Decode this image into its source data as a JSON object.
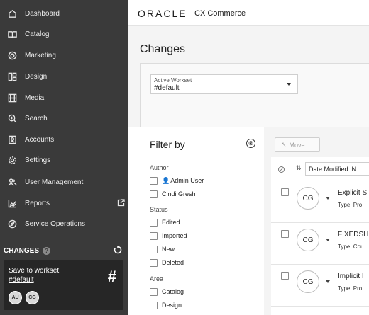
{
  "sidebar": {
    "items": [
      {
        "label": "Dashboard",
        "icon": "home-icon"
      },
      {
        "label": "Catalog",
        "icon": "book-icon"
      },
      {
        "label": "Marketing",
        "icon": "target-icon"
      },
      {
        "label": "Design",
        "icon": "layout-icon"
      },
      {
        "label": "Media",
        "icon": "media-icon"
      },
      {
        "label": "Search",
        "icon": "search-icon"
      },
      {
        "label": "Accounts",
        "icon": "accounts-icon"
      },
      {
        "label": "Settings",
        "icon": "gear-icon"
      },
      {
        "label": "User Management",
        "icon": "users-icon"
      },
      {
        "label": "Reports",
        "icon": "reports-icon"
      },
      {
        "label": "Service Operations",
        "icon": "compass-icon"
      }
    ],
    "changes_label": "CHANGES",
    "changes_help": "?",
    "workset_card": {
      "line1": "Save to workset",
      "line2": "#default",
      "avatars": [
        "AU",
        "CG"
      ]
    }
  },
  "header": {
    "logo": "ORACLE",
    "product": "CX Commerce"
  },
  "main": {
    "title": "Changes",
    "workset_select": {
      "label": "Active Workset",
      "value": "#default"
    },
    "filter": {
      "title": "Filter by",
      "clear_symbol": "⊗",
      "sections": [
        {
          "heading": "Author",
          "options": [
            "Admin User",
            "Cindi Gresh"
          ]
        },
        {
          "heading": "Status",
          "options": [
            "Edited",
            "Imported",
            "New",
            "Deleted"
          ]
        },
        {
          "heading": "Area",
          "options": [
            "Catalog",
            "Design"
          ]
        }
      ]
    },
    "results": {
      "move_label": "Move...",
      "sort_label": "Date Modified: N",
      "rows": [
        {
          "avatar": "CG",
          "title": "Explicit S",
          "type": "Type: Pro"
        },
        {
          "avatar": "CG",
          "title": "FIXEDSH",
          "type": "Type: Cou"
        },
        {
          "avatar": "CG",
          "title": "Implicit I",
          "type": "Type: Pro"
        }
      ]
    }
  },
  "colors": {
    "sidebar_bg": "#3a3a3a",
    "card_bg": "#262626",
    "main_bg": "#f4f4f4"
  }
}
